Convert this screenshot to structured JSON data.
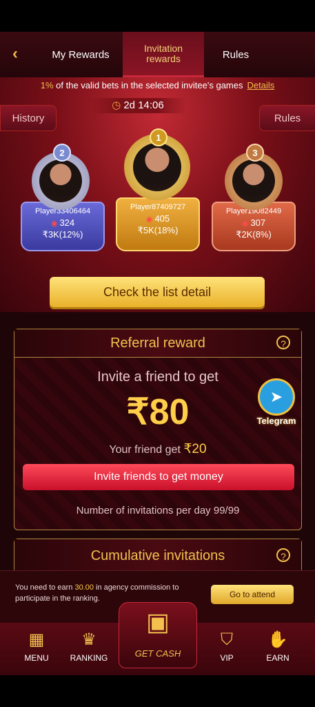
{
  "header": {
    "tabs": [
      {
        "label": "My Rewards"
      },
      {
        "label": "Invitation rewards"
      },
      {
        "label": "Rules"
      }
    ]
  },
  "hero": {
    "info_highlight": "1%",
    "info_text": " of the valid bets in the selected invitee's games",
    "details_link": "Details",
    "history_label": "History",
    "rules_label": "Rules",
    "timer": "2d 14:06",
    "podium": [
      {
        "rank": "2",
        "name": "Player33406464",
        "score": "324",
        "amount": "₹3K(12%)"
      },
      {
        "rank": "1",
        "name": "Player87409727",
        "score": "405",
        "amount": "₹5K(18%)"
      },
      {
        "rank": "3",
        "name": "Player19082449",
        "score": "307",
        "amount": "₹2K(8%)"
      }
    ],
    "check_button": "Check the list detail"
  },
  "referral": {
    "title": "Referral reward",
    "help_icon": "?",
    "invite_title": "Invite a friend to get",
    "amount": "₹80",
    "friend_get_label": "Your friend get",
    "friend_get_value": "₹20",
    "invite_button": "Invite friends to get money",
    "per_day_label": "Number of invitations per day",
    "per_day_value": "99/99"
  },
  "telegram": {
    "label": "Telegram"
  },
  "cumulative": {
    "title": "Cumulative invitations",
    "help_icon": "?"
  },
  "notice": {
    "text_before": "You need to earn ",
    "amount": "30.00",
    "text_after": " in agency commission to participate in the ranking.",
    "button": "Go to attend"
  },
  "nav": {
    "menu": "MENU",
    "ranking": "RANKING",
    "get_cash": "GET CASH",
    "vip": "VIP",
    "earn": "EARN"
  },
  "colors": {
    "accent": "#f2c14e",
    "primary": "#c8102a",
    "background": "#1e0508"
  }
}
